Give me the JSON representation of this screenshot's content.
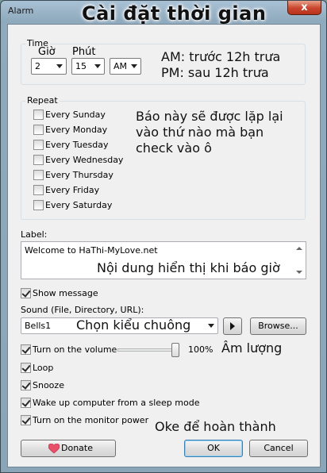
{
  "window": {
    "title": "Alarm",
    "overlay_title": "Cài đặt thời gian",
    "close_glyph": "x"
  },
  "time": {
    "legend": "Time",
    "hour_label": "Giờ",
    "minute_label": "Phút",
    "hour_value": "2",
    "minute_value": "15",
    "ampm_value": "AM",
    "note_am": "AM: trước 12h trưa",
    "note_pm": "PM: sau 12h trưa"
  },
  "repeat": {
    "legend": "Repeat",
    "days": [
      {
        "label": "Every Sunday",
        "checked": false
      },
      {
        "label": "Every Monday",
        "checked": false
      },
      {
        "label": "Every Tuesday",
        "checked": false
      },
      {
        "label": "Every Wednesday",
        "checked": false
      },
      {
        "label": "Every Thursday",
        "checked": false
      },
      {
        "label": "Every Friday",
        "checked": false
      },
      {
        "label": "Every Saturday",
        "checked": false
      }
    ],
    "note_line1": "Báo này sẽ được lặp lại",
    "note_line2": "vào thứ nào mà bạn",
    "note_line3": "check vào ô"
  },
  "label": {
    "caption": "Label:",
    "value": "Welcome to HaThi-MyLove.net",
    "note": "Nội dung hiển thị khi báo giờ"
  },
  "show_message": {
    "label": "Show message",
    "checked": true
  },
  "sound": {
    "caption": "Sound (File, Directory, URL):",
    "value": "Bells1",
    "note": "Chọn kiểu chuông",
    "browse_label": "Browse..."
  },
  "options": {
    "volume": {
      "label": "Turn on the volume",
      "checked": true,
      "percent_text": "100%",
      "level": 1.0,
      "note": "Âm lượng"
    },
    "loop": {
      "label": "Loop",
      "checked": true
    },
    "snooze": {
      "label": "Snooze",
      "checked": true
    },
    "wake": {
      "label": "Wake up computer from a sleep mode",
      "checked": true
    },
    "monitor": {
      "label": "Turn on the monitor power",
      "checked": true
    }
  },
  "footer": {
    "note": "Oke để hoàn thành",
    "donate_label": "Donate",
    "ok_label": "OK",
    "cancel_label": "Cancel"
  },
  "colors": {
    "title_bar": "#8fa9bd",
    "close_button": "#c9452c",
    "dialog_background": "#f0f0f0",
    "heart": "#e8506a"
  },
  "icons": {
    "close": "close-icon",
    "dropdown": "chevron-down-icon",
    "play": "play-icon",
    "donate": "heart-icon"
  }
}
